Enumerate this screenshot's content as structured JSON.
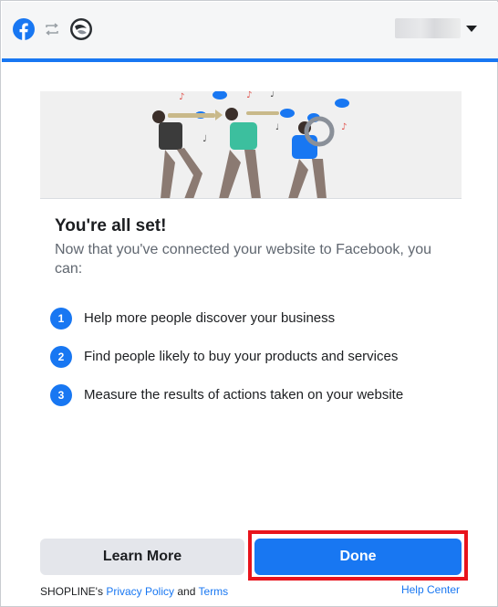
{
  "header": {
    "facebook_logo_icon": "facebook-logo-icon",
    "sync_icon": "sync-arrows-icon",
    "partner_logo_icon": "shopline-logo-icon",
    "account_menu_icon": "chevron-down-icon",
    "accent_color": "#1877f2"
  },
  "main": {
    "title": "You're all set!",
    "subtitle": "Now that you've connected your website to Facebook, you can:",
    "steps": [
      {
        "number": "1",
        "text": "Help more people discover your business"
      },
      {
        "number": "2",
        "text": "Find people likely to buy your products and services"
      },
      {
        "number": "3",
        "text": "Measure the results of actions taken on your website"
      }
    ]
  },
  "footer": {
    "learn_more_label": "Learn More",
    "done_label": "Done",
    "legal_prefix": "SHOPLINE's",
    "privacy_policy_label": "Privacy Policy",
    "legal_and": "and",
    "terms_label": "Terms",
    "help_center_label": "Help Center",
    "highlight_color": "#e8141c"
  }
}
